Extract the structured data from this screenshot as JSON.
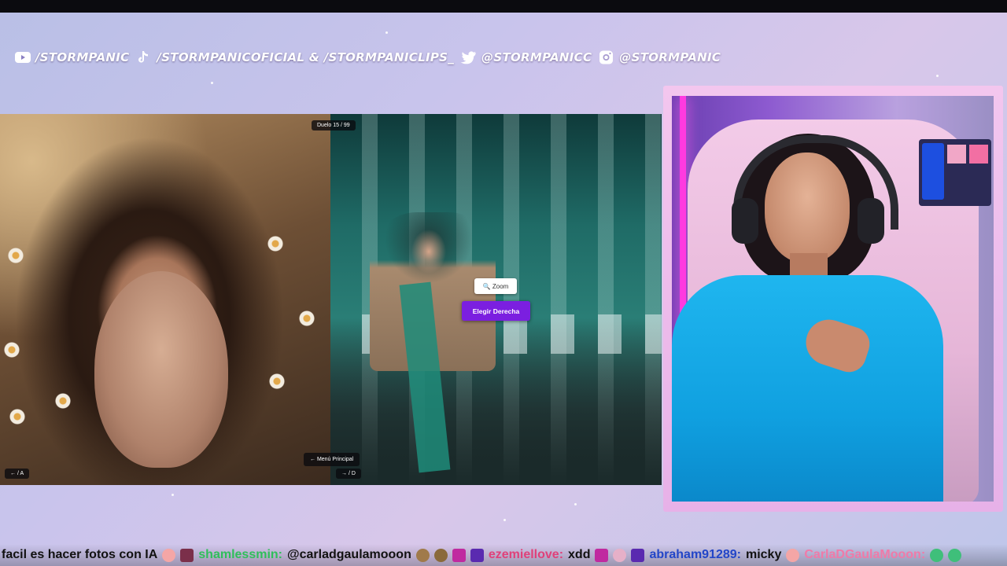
{
  "socials": [
    {
      "icon": "youtube-icon",
      "label": "/STORMPANIC"
    },
    {
      "icon": "tiktok-icon",
      "label": "/STORMPANICOFICIAL & /STORMPANICLIPS_"
    },
    {
      "icon": "twitter-icon",
      "label": "@STORMPANICC"
    },
    {
      "icon": "instagram-icon",
      "label": "@STORMPANIC"
    }
  ],
  "game": {
    "duel_counter": "Duelo 15 / 99",
    "zoom_label": "🔍 Zoom",
    "choose_right_label": "Elegir Derecha",
    "main_menu_label": "← Menú Principal",
    "left_hint": "← / A",
    "right_hint": "→ / D"
  },
  "chat": {
    "segments": [
      {
        "type": "text",
        "text": "facil es hacer fotos con IA",
        "color": "#111111"
      },
      {
        "type": "user",
        "text": "shamlessmin:",
        "color": "#2fbf5a"
      },
      {
        "type": "text",
        "text": "@carladgaulamooon",
        "color": "#111111"
      },
      {
        "type": "user",
        "text": "ezemiellove:",
        "color": "#e0417a"
      },
      {
        "type": "text",
        "text": "xdd",
        "color": "#111111"
      },
      {
        "type": "user",
        "text": "abraham91289:",
        "color": "#2346c8"
      },
      {
        "type": "text",
        "text": "micky",
        "color": "#111111"
      },
      {
        "type": "user",
        "text": "CarlaDGaulaMooon:",
        "color": "#f07aa8"
      }
    ]
  },
  "colors": {
    "accent_purple": "#7b1fe0",
    "cam_border": "#f3c6ee"
  }
}
